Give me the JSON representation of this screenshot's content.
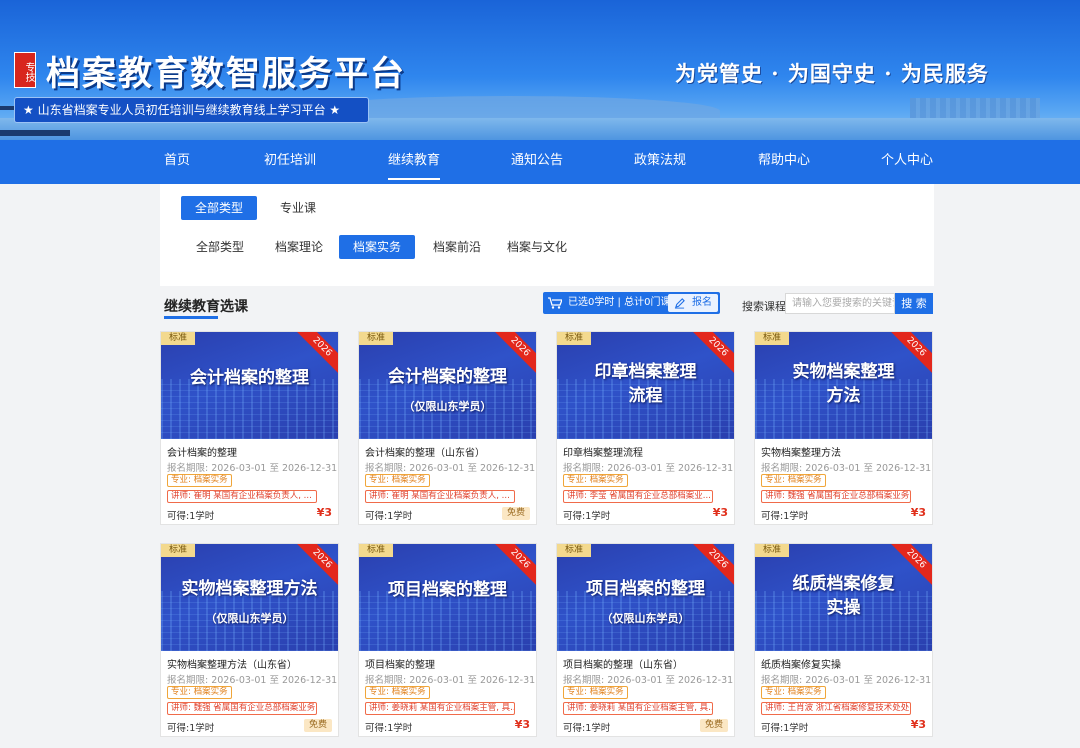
{
  "header": {
    "seal_text": "专技",
    "site_title": "档案教育数智服务平台",
    "subtitle": "★ 山东省档案专业人员初任培训与继续教育线上学习平台 ★",
    "slogan": "为党管史 · 为国守史 · 为民服务"
  },
  "nav": {
    "items": [
      {
        "label": "首页",
        "active": false
      },
      {
        "label": "初任培训",
        "active": false
      },
      {
        "label": "继续教育",
        "active": true
      },
      {
        "label": "通知公告",
        "active": false
      },
      {
        "label": "政策法规",
        "active": false
      },
      {
        "label": "帮助中心",
        "active": false
      },
      {
        "label": "个人中心",
        "active": false
      }
    ]
  },
  "filters": {
    "row1": [
      {
        "label": "全部类型",
        "selected": true
      },
      {
        "label": "专业课",
        "selected": false
      }
    ],
    "row2": [
      {
        "label": "全部类型",
        "selected": false
      },
      {
        "label": "档案理论",
        "selected": false
      },
      {
        "label": "档案实务",
        "selected": true
      },
      {
        "label": "档案前沿",
        "selected": false
      },
      {
        "label": "档案与文化",
        "selected": false
      }
    ]
  },
  "section": {
    "title": "继续教育选课",
    "cart_text": "已选0学时 | 总计0门课程",
    "signup_label": "报名",
    "search_label": "搜索课程",
    "search_placeholder": "请输入您要搜索的关键词",
    "search_button": "搜 索"
  },
  "courses": [
    {
      "badge": "标准",
      "ribbon": "2026",
      "thumb_title": "会计档案的整理",
      "thumb_sub": "",
      "title": "会计档案的整理",
      "date": "报名期限: 2026-03-01 至 2026-12-31",
      "major": "专业: 档案实务",
      "teacher": "讲师: 崔明 某国有企业档案负责人, ...",
      "hours": "可得:1学时",
      "price": "¥3",
      "free": false
    },
    {
      "badge": "标准",
      "ribbon": "2026",
      "thumb_title": "会计档案的整理",
      "thumb_sub": "（仅限山东学员）",
      "title": "会计档案的整理（山东省）",
      "date": "报名期限: 2026-03-01 至 2026-12-31",
      "major": "专业: 档案实务",
      "teacher": "讲师: 崔明 某国有企业档案负责人, ...",
      "hours": "可得:1学时",
      "price": "免费",
      "free": true
    },
    {
      "badge": "标准",
      "ribbon": "2026",
      "thumb_title": "印章档案整理\n流程",
      "thumb_sub": "",
      "title": "印章档案整理流程",
      "date": "报名期限: 2026-03-01 至 2026-12-31",
      "major": "专业: 档案实务",
      "teacher": "讲师: 李莹 省属国有企业总部档案业...",
      "hours": "可得:1学时",
      "price": "¥3",
      "free": false
    },
    {
      "badge": "标准",
      "ribbon": "2026",
      "thumb_title": "实物档案整理\n方法",
      "thumb_sub": "",
      "title": "实物档案整理方法",
      "date": "报名期限: 2026-03-01 至 2026-12-31",
      "major": "专业: 档案实务",
      "teacher": "讲师: 魏强 省属国有企业总部档案业务...",
      "hours": "可得:1学时",
      "price": "¥3",
      "free": false
    },
    {
      "badge": "标准",
      "ribbon": "2026",
      "thumb_title": "实物档案整理方法",
      "thumb_sub": "（仅限山东学员）",
      "title": "实物档案整理方法（山东省）",
      "date": "报名期限: 2026-03-01 至 2026-12-31",
      "major": "专业: 档案实务",
      "teacher": "讲师: 魏强 省属国有企业总部档案业务...",
      "hours": "可得:1学时",
      "price": "免费",
      "free": true
    },
    {
      "badge": "标准",
      "ribbon": "2026",
      "thumb_title": "项目档案的整理",
      "thumb_sub": "",
      "title": "项目档案的整理",
      "date": "报名期限: 2026-03-01 至 2026-12-31",
      "major": "专业: 档案实务",
      "teacher": "讲师: 姜晓莉 某国有企业档案主管, 具...",
      "hours": "可得:1学时",
      "price": "¥3",
      "free": false
    },
    {
      "badge": "标准",
      "ribbon": "2026",
      "thumb_title": "项目档案的整理",
      "thumb_sub": "（仅限山东学员）",
      "title": "项目档案的整理（山东省）",
      "date": "报名期限: 2026-03-01 至 2026-12-31",
      "major": "专业: 档案实务",
      "teacher": "讲师: 姜晓莉 某国有企业档案主管, 具...",
      "hours": "可得:1学时",
      "price": "免费",
      "free": true
    },
    {
      "badge": "标准",
      "ribbon": "2026",
      "thumb_title": "纸质档案修复\n实操",
      "thumb_sub": "",
      "title": "纸质档案修复实操",
      "date": "报名期限: 2026-03-01 至 2026-12-31",
      "major": "专业: 档案实务",
      "teacher": "讲师: 王肖波 浙江省档案修复技术处处...",
      "hours": "可得:1学时",
      "price": "¥3",
      "free": false
    }
  ]
}
